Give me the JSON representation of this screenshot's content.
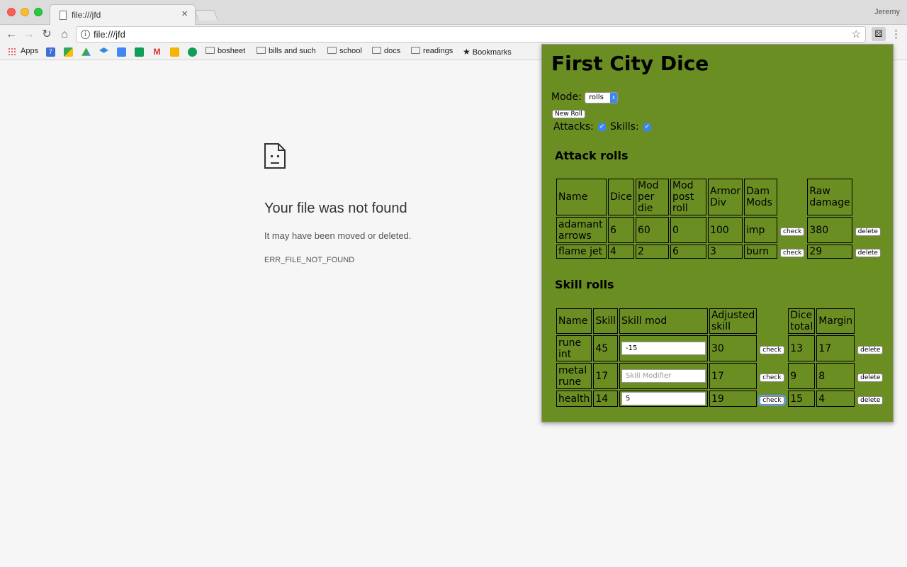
{
  "browser": {
    "tab_title": "file:///jfd",
    "profile_name": "Jeremy",
    "url": "file:///jfd",
    "bookmarks": [
      {
        "label": "Apps"
      },
      {
        "label": "bosheet"
      },
      {
        "label": "bills and such"
      },
      {
        "label": "school"
      },
      {
        "label": "docs"
      },
      {
        "label": "readings"
      },
      {
        "label": "Bookmarks"
      }
    ]
  },
  "error_page": {
    "title": "Your file was not found",
    "description": "It may have been moved or deleted.",
    "code": "ERR_FILE_NOT_FOUND"
  },
  "popup": {
    "title": "First City Dice",
    "background_color": "#6b8e23",
    "mode_label": "Mode:",
    "mode_value": "rolls",
    "new_roll_label": "New Roll",
    "attacks_label": "Attacks:",
    "attacks_checked": true,
    "skills_label": "Skills:",
    "skills_checked": true,
    "attack_heading": "Attack rolls",
    "attack_headers": [
      "Name",
      "Dice",
      "Mod per die",
      "Mod post roll",
      "Armor Div",
      "Dam Mods",
      "Raw damage"
    ],
    "attack_rows": [
      {
        "name": "adamant arrows",
        "dice": "6",
        "mod_per_die": "60",
        "mod_post_roll": "0",
        "armor_div": "100",
        "dam_mods": "imp",
        "check_label": "check",
        "raw_damage": "380",
        "delete_label": "delete"
      },
      {
        "name": "flame jet",
        "dice": "4",
        "mod_per_die": "2",
        "mod_post_roll": "6",
        "armor_div": "3",
        "dam_mods": "burn",
        "check_label": "check",
        "raw_damage": "29",
        "delete_label": "delete"
      }
    ],
    "skill_heading": "Skill rolls",
    "skill_headers": [
      "Name",
      "Skill",
      "Skill mod",
      "Adjusted skill",
      "Dice total",
      "Margin"
    ],
    "skill_rows": [
      {
        "name": "rune int",
        "skill": "45",
        "skill_mod_value": "-15",
        "adjusted_skill": "30",
        "check_label": "check",
        "dice_total": "13",
        "margin": "17",
        "delete_label": "delete"
      },
      {
        "name": "metal rune",
        "skill": "17",
        "skill_mod_value": "",
        "skill_mod_placeholder": "Skill Modifier",
        "adjusted_skill": "17",
        "check_label": "check",
        "dice_total": "9",
        "margin": "8",
        "delete_label": "delete"
      },
      {
        "name": "health",
        "skill": "14",
        "skill_mod_value": "5",
        "adjusted_skill": "19",
        "check_label": "check",
        "dice_total": "15",
        "margin": "4",
        "delete_label": "delete"
      }
    ]
  }
}
